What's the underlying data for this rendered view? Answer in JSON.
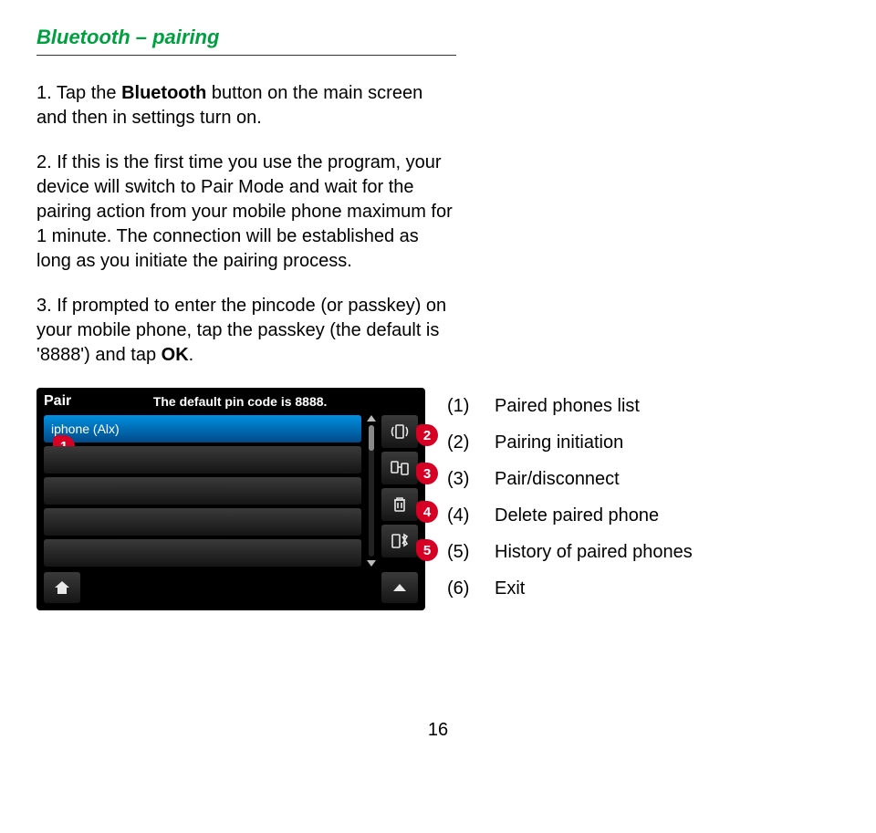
{
  "heading": "Bluetooth – pairing",
  "steps": {
    "s1": {
      "num": "1.",
      "pre": "Tap the ",
      "bold": "Bluetooth",
      "post": " button on the main screen and then in settings turn on."
    },
    "s2": {
      "num": "2.",
      "text": "If this is the first time you use the program, your device will switch to Pair Mode and wait for the pairing action from your mobile phone maximum for 1 minute. The connection will be established as long as you initiate the pairing process."
    },
    "s3": {
      "num": "3.",
      "pre": "If prompted to enter the pincode (or passkey) on your mobile phone, tap the passkey (the default is '8888') and tap ",
      "bold": "OK",
      "post": "."
    }
  },
  "device": {
    "title": "Pair",
    "subtitle": "The default pin code is 8888.",
    "selected": "iphone (Alx)"
  },
  "badges": {
    "b1": "1",
    "b2": "2",
    "b3": "3",
    "b4": "4",
    "b5": "5"
  },
  "legend": [
    {
      "n": "(1)",
      "t": "Paired phones list"
    },
    {
      "n": "(2)",
      "t": "Pairing initiation"
    },
    {
      "n": "(3)",
      "t": "Pair/disconnect"
    },
    {
      "n": "(4)",
      "t": "Delete paired phone"
    },
    {
      "n": "(5)",
      "t": "History of paired phones"
    },
    {
      "n": "(6)",
      "t": "Exit"
    }
  ],
  "page_number": "16"
}
